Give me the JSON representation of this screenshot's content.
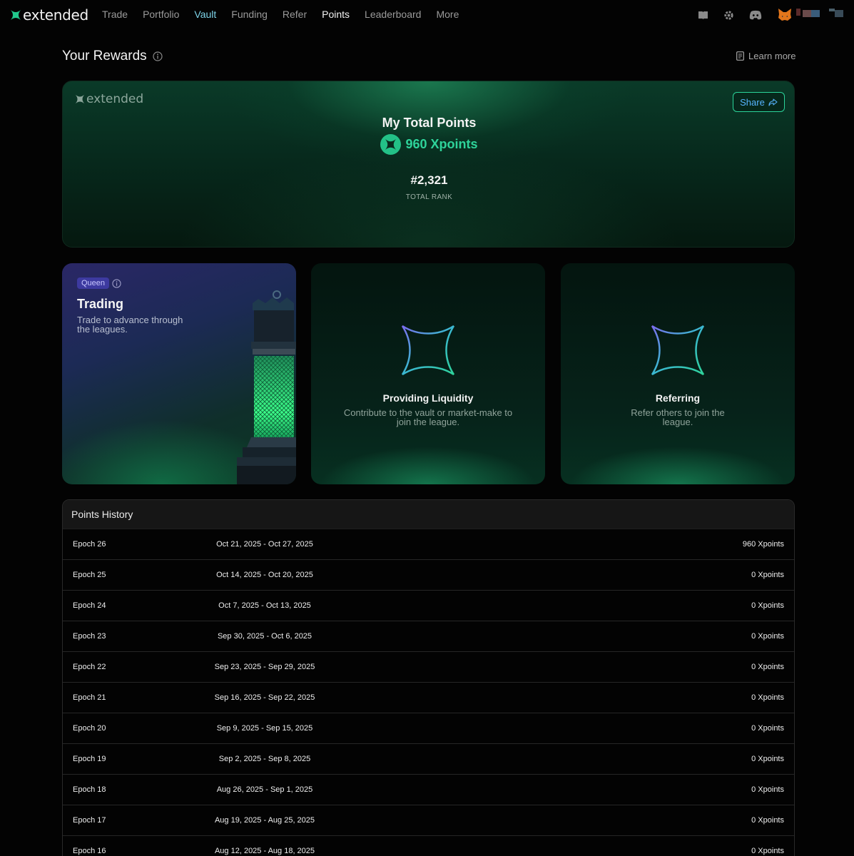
{
  "nav": {
    "brand": "extended",
    "items": [
      "Trade",
      "Portfolio",
      "Vault",
      "Funding",
      "Refer",
      "Points",
      "Leaderboard",
      "More"
    ],
    "active": "Points"
  },
  "header": {
    "title": "Your Rewards",
    "learn_more": "Learn more"
  },
  "hero": {
    "brand": "extended",
    "share_label": "Share",
    "title": "My Total Points",
    "points": "960 Xpoints",
    "rank": "#2,321",
    "rank_label": "TOTAL RANK"
  },
  "cards": {
    "trading": {
      "badge": "Queen",
      "title": "Trading",
      "desc": "Trade to advance through the leagues."
    },
    "liquidity": {
      "title": "Providing Liquidity",
      "desc": "Contribute to the vault or market-make to join the league."
    },
    "referring": {
      "title": "Referring",
      "desc": "Refer others to join the league."
    }
  },
  "history": {
    "title": "Points History",
    "rows": [
      {
        "epoch": "Epoch 26",
        "dates": "Oct 21, 2025 - Oct 27, 2025",
        "points": "960 Xpoints"
      },
      {
        "epoch": "Epoch 25",
        "dates": "Oct 14, 2025 - Oct 20, 2025",
        "points": "0 Xpoints"
      },
      {
        "epoch": "Epoch 24",
        "dates": "Oct 7, 2025 - Oct 13, 2025",
        "points": "0 Xpoints"
      },
      {
        "epoch": "Epoch 23",
        "dates": "Sep 30, 2025 - Oct 6, 2025",
        "points": "0 Xpoints"
      },
      {
        "epoch": "Epoch 22",
        "dates": "Sep 23, 2025 - Sep 29, 2025",
        "points": "0 Xpoints"
      },
      {
        "epoch": "Epoch 21",
        "dates": "Sep 16, 2025 - Sep 22, 2025",
        "points": "0 Xpoints"
      },
      {
        "epoch": "Epoch 20",
        "dates": "Sep 9, 2025 - Sep 15, 2025",
        "points": "0 Xpoints"
      },
      {
        "epoch": "Epoch 19",
        "dates": "Sep 2, 2025 - Sep 8, 2025",
        "points": "0 Xpoints"
      },
      {
        "epoch": "Epoch 18",
        "dates": "Aug 26, 2025 - Sep 1, 2025",
        "points": "0 Xpoints"
      },
      {
        "epoch": "Epoch 17",
        "dates": "Aug 19, 2025 - Aug 25, 2025",
        "points": "0 Xpoints"
      },
      {
        "epoch": "Epoch 16",
        "dates": "Aug 12, 2025 - Aug 18, 2025",
        "points": "0 Xpoints"
      }
    ]
  },
  "icons": {
    "nav_right": [
      "book-icon",
      "gear-icon",
      "discord-icon",
      "metamask-fox-icon"
    ],
    "accent": "#2ed39a",
    "link_blue": "#56b3ff"
  }
}
